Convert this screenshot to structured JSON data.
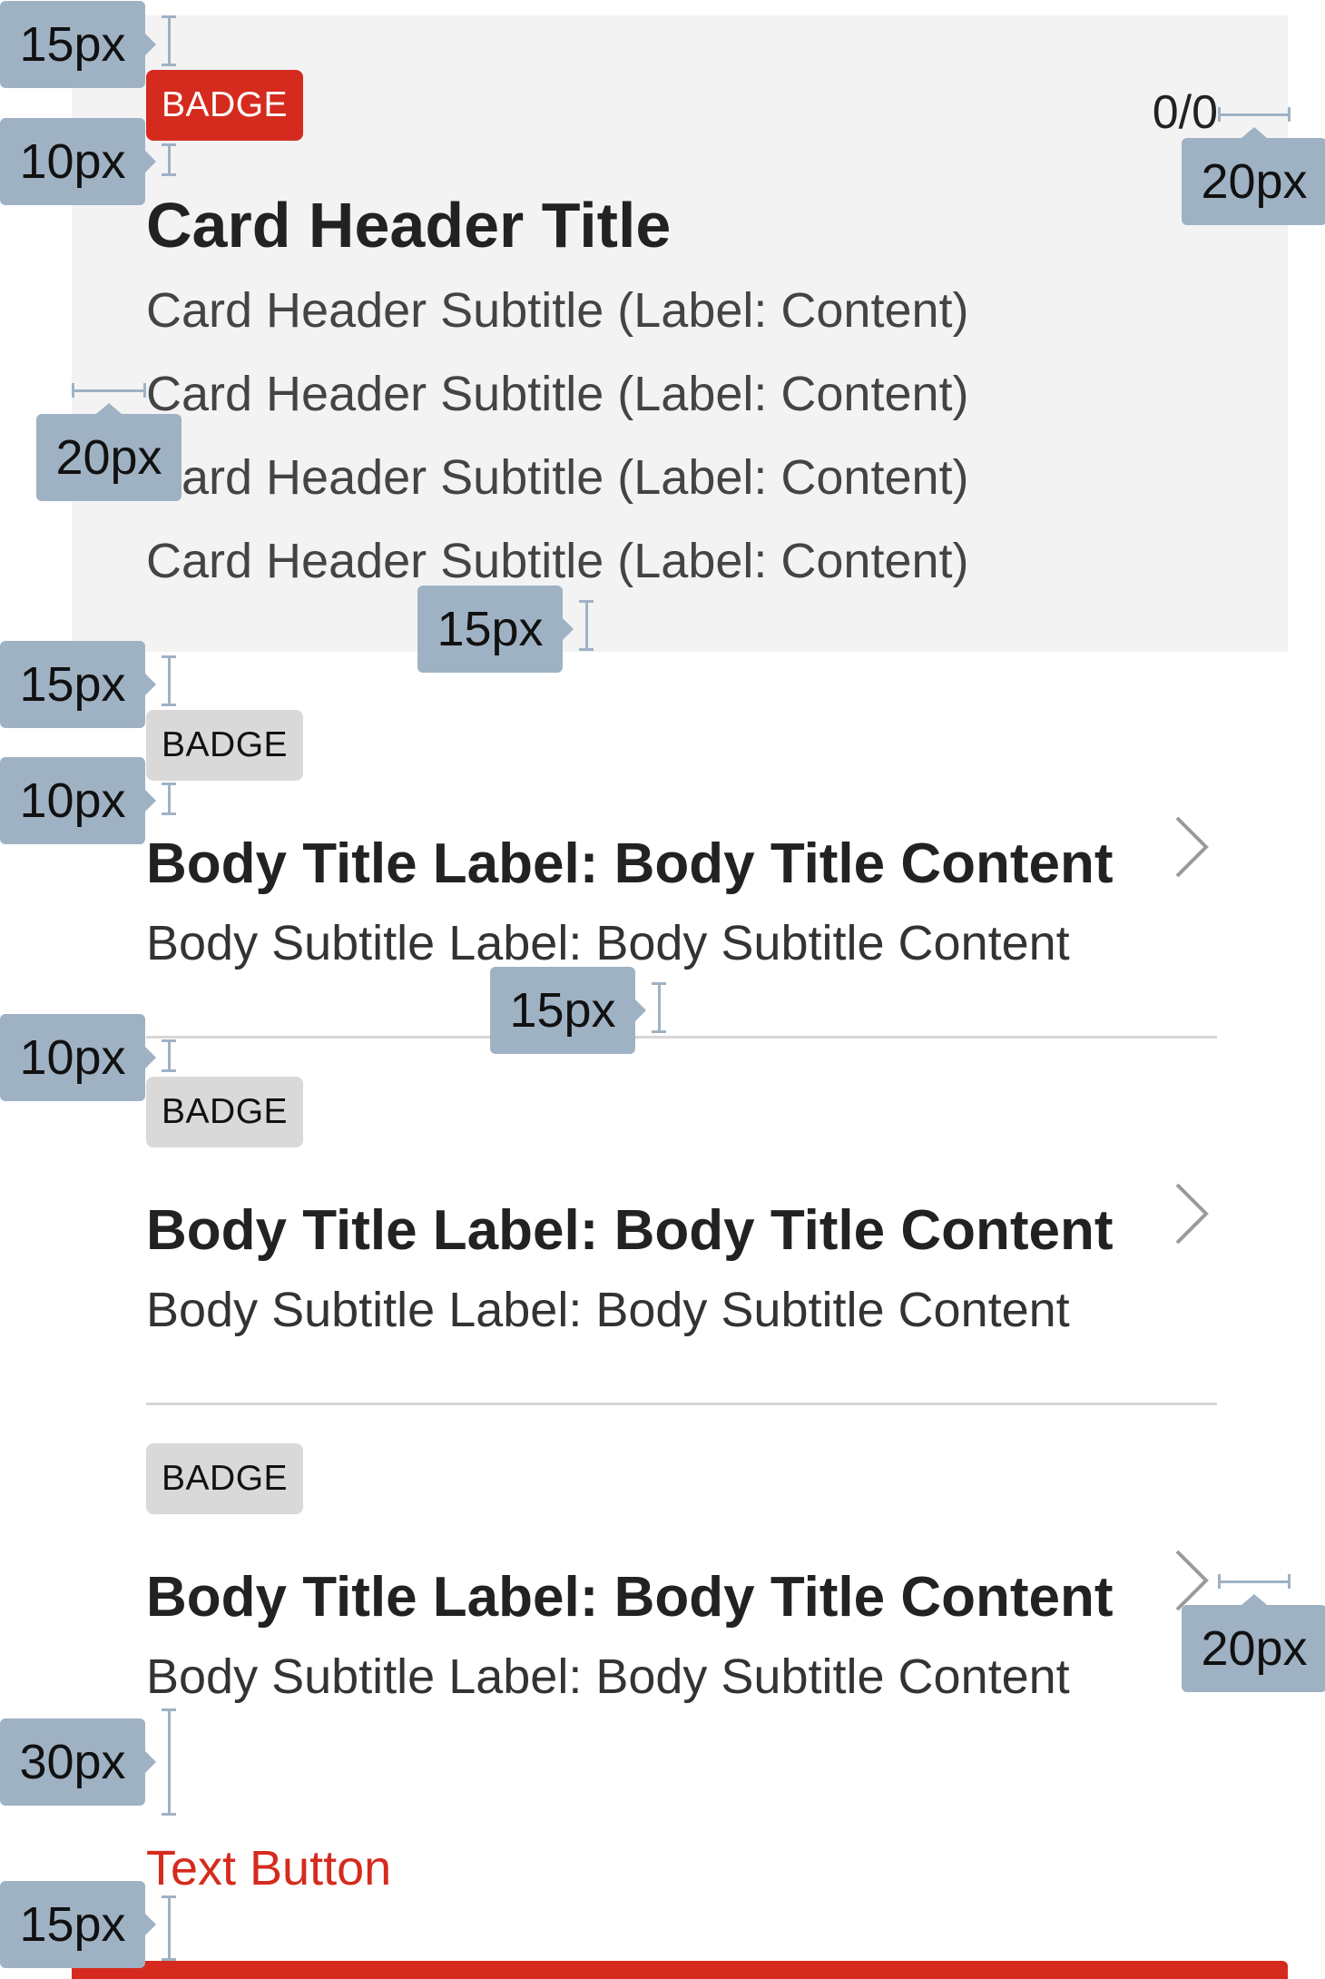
{
  "card_header": {
    "badge": "BADGE",
    "counter": "0/0",
    "title": "Card Header Title",
    "subtitles": [
      "Card Header Subtitle (Label: Content)",
      "Card Header Subtitle (Label: Content)",
      "Card Header Subtitle (Label: Content)",
      "Card Header Subtitle (Label: Content)"
    ]
  },
  "body_items": [
    {
      "badge": "BADGE",
      "title": "Body Title Label: Body Title Content",
      "subtitle": "Body Subtitle Label: Body Subtitle Content"
    },
    {
      "badge": "BADGE",
      "title": "Body Title Label: Body Title Content",
      "subtitle": "Body Subtitle Label: Body Subtitle Content"
    },
    {
      "badge": "BADGE",
      "title": "Body Title Label: Body Title Content",
      "subtitle": "Body Subtitle Label: Body Subtitle Content"
    }
  ],
  "text_button": "Text Button",
  "annotations": [
    "15px",
    "10px",
    "20px",
    "20px",
    "15px",
    "15px",
    "10px",
    "15px",
    "10px",
    "20px",
    "30px",
    "15px"
  ],
  "colors": {
    "accent": "#d52b1e",
    "header_background": "#f3f3f4",
    "badge_gray": "#d9d9d9",
    "annotation": "#9fb2c4",
    "divider": "#d6d6d6"
  },
  "icons": {
    "row_chevron": "chevron-right-icon"
  }
}
